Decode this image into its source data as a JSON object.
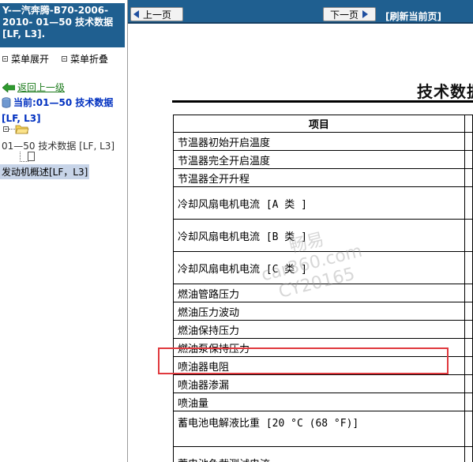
{
  "sidebar": {
    "doc_title": "Y-—汽奔腾-B70-2006-2010- 01—50 技术数据 [LF, L3].",
    "expand_label": "菜单展开",
    "collapse_label": "菜单折叠",
    "back_label": "返回上一级",
    "current_line1": "当前:01—50 技术数据",
    "current_line2": "[LF, L3]",
    "tree_node_label": "01—50 技术数据 [LF, L3]",
    "selected_item_label": "发动机概述[LF，L3]"
  },
  "nav": {
    "prev_label": "上一页",
    "next_label": "下一页",
    "refresh_label": "[刷新当前页]"
  },
  "main": {
    "heading": "技术数据",
    "table_header": "项目",
    "rows": [
      "节温器初始开启温度",
      "节温器完全开启温度",
      "节温器全开升程",
      "冷却风扇电机电流 [A 类 ]",
      "冷却风扇电机电流 [B 类 ]",
      "冷却风扇电机电流 [C 类 ]",
      "燃油管路压力",
      "燃油压力波动",
      "燃油保持压力",
      "燃油泵保持压力",
      "喷油器电阻",
      "喷油器渗漏",
      "喷油量",
      "蓄电池电解液比重 [20 °C (68 °F)]",
      "蓄电池负载测试电流"
    ]
  },
  "watermark": {
    "line1": "畅易",
    "line2": "car360.com",
    "line3": "CY20165"
  },
  "colors": {
    "header_blue": "#1f5f90",
    "highlight_red": "#e0393e",
    "selected_bg": "#c7d4e8",
    "link_green": "#1b7a1b",
    "current_blue": "#0030c0"
  }
}
